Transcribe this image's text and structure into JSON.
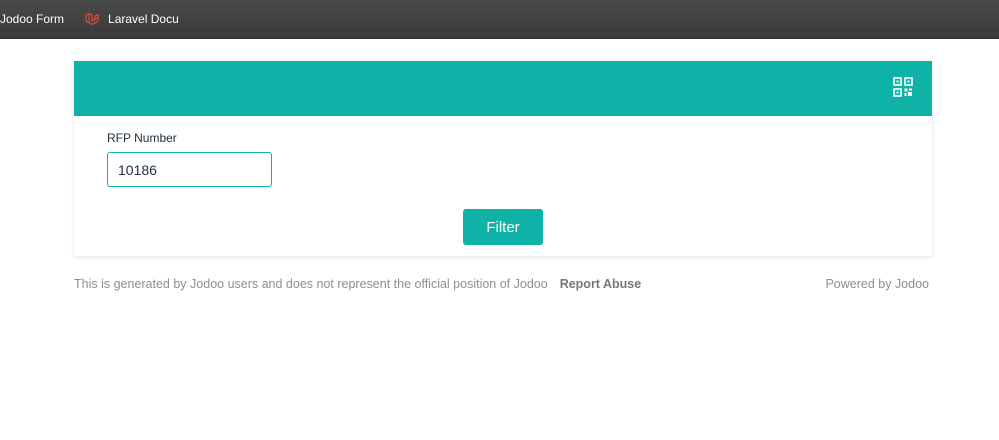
{
  "bookmarks": [
    {
      "label": "Jodoo Form",
      "icon": "jodoo-icon"
    },
    {
      "label": "Laravel Docu",
      "icon": "laravel-icon"
    }
  ],
  "form": {
    "field_label": "RFP Number",
    "field_value": "10186",
    "filter_label": "Filter",
    "qr_icon": "qr-code-icon"
  },
  "footer": {
    "disclaimer": "This is generated by Jodoo users and does not represent the official position of Jodoo",
    "report_abuse": "Report Abuse",
    "powered_by": "Powered by Jodoo"
  },
  "colors": {
    "accent": "#0fb2a6",
    "bookmarks_bar": "#3e3e3e",
    "footer_text": "#8a8f99"
  }
}
